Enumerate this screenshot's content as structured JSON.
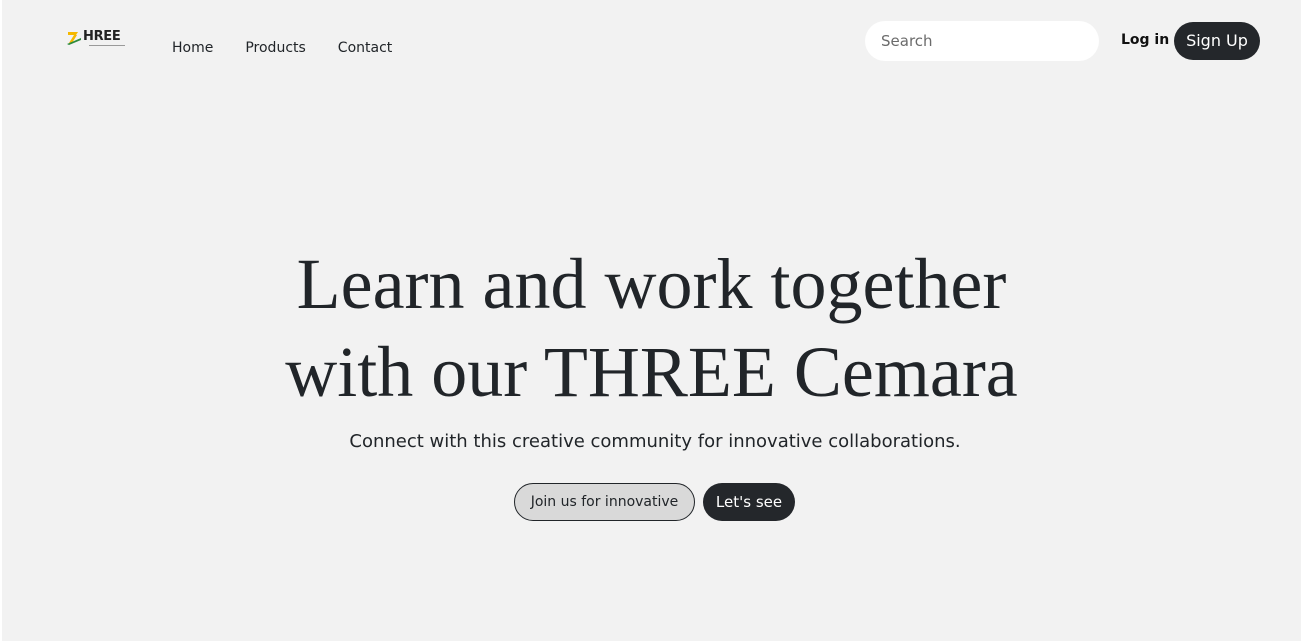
{
  "navbar": {
    "logo": {
      "text": "HREE",
      "icon": "three-logo-icon",
      "colors": {
        "yellow": "#f5b800",
        "green": "#2e8b3d"
      }
    },
    "links": [
      {
        "label": "Home"
      },
      {
        "label": "Products"
      },
      {
        "label": "Contact"
      }
    ],
    "search": {
      "placeholder": "Search",
      "value": ""
    },
    "login_label": "Log in",
    "signup_label": "Sign Up"
  },
  "hero": {
    "title_line1": "Learn and work together",
    "title_line2": "with our THREE Cemara",
    "subtitle": "Connect with this creative community for innovative collaborations.",
    "primary_button": "Join us for innovative",
    "secondary_button": "Let's see"
  },
  "colors": {
    "background": "#f2f2f2",
    "dark": "#24272b",
    "outline_button_bg": "#d9d9d9",
    "text": "#212529"
  }
}
